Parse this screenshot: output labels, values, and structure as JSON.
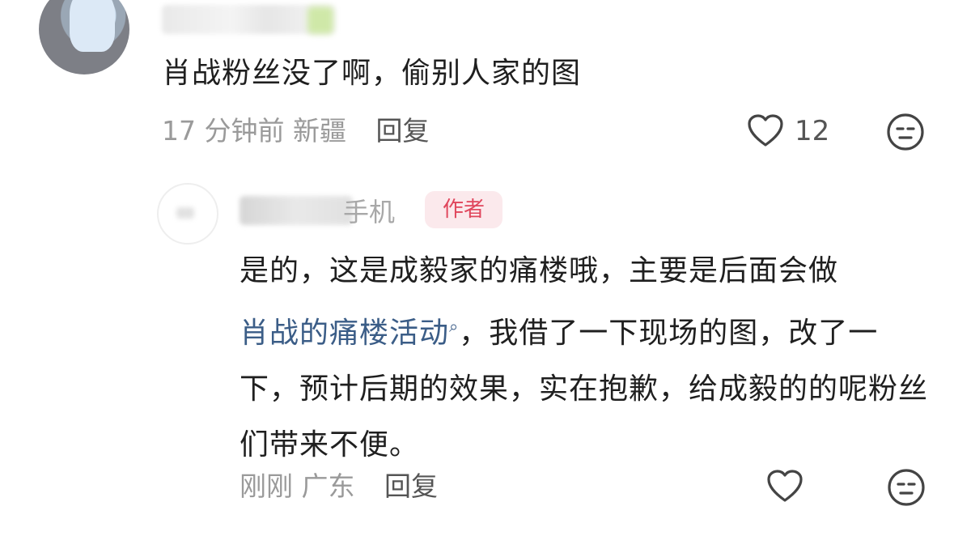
{
  "comment1": {
    "text": "肖战粉丝没了啊，偷别人家的图",
    "time": "17 分钟前",
    "location": "新疆",
    "reply_label": "回复",
    "like_count": "12"
  },
  "reply": {
    "username_visible": "手机",
    "author_badge": "作者",
    "text_part1": "是的，这是成毅家的痛楼哦，主要是后面会做",
    "link_text": "肖战的痛楼活动",
    "text_part2": "，我借了一下现场的图，改了一下，预计后期的效果，实在抱歉，给成毅的的呢粉丝们带来不便。",
    "time": "刚刚",
    "location": "广东",
    "reply_label": "回复"
  },
  "icons": {
    "like": "heart-outline-icon",
    "emoji": "neutral-face-icon",
    "search": "search-icon"
  },
  "colors": {
    "link": "#3b5d87",
    "author_badge_text": "#e0465c",
    "author_badge_bg": "#fbe9ec",
    "meta": "#9a9a9a"
  }
}
